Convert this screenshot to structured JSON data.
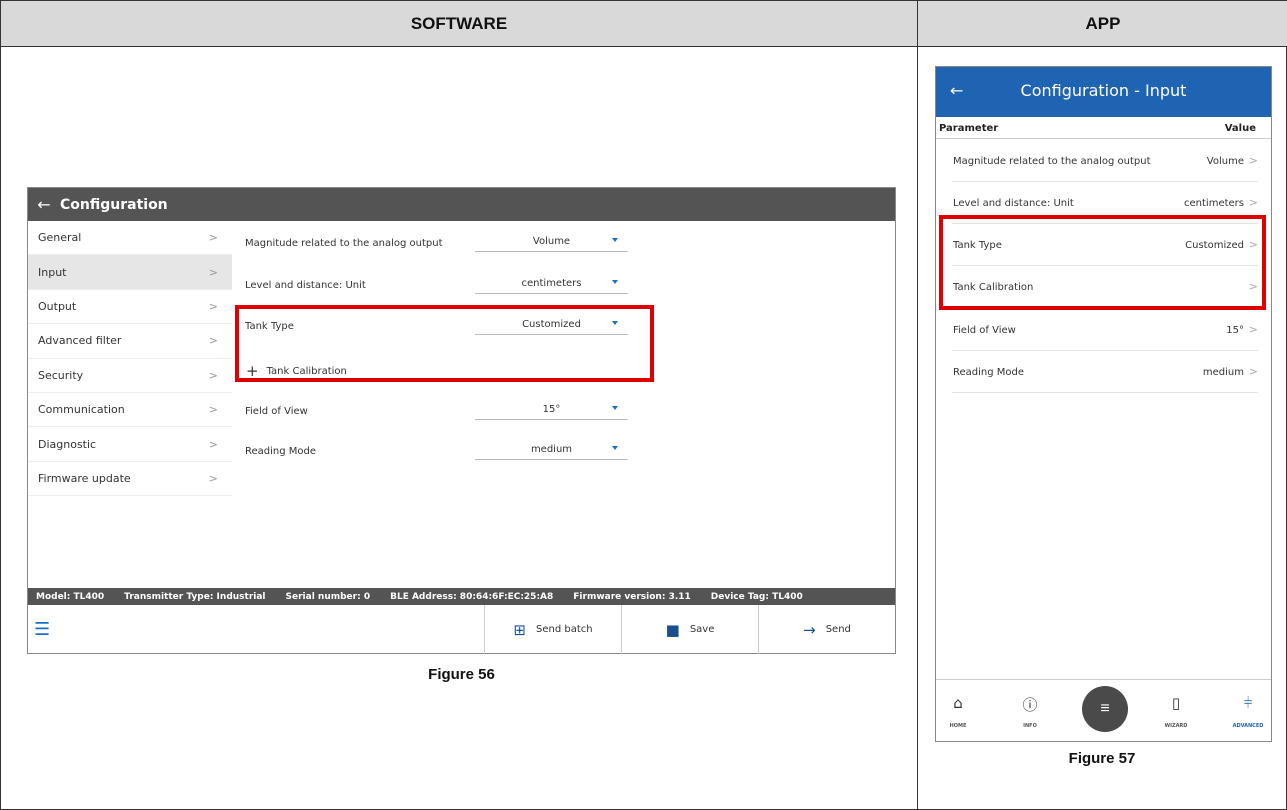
{
  "table": {
    "software_header": "SOFTWARE",
    "app_header": "APP",
    "software_caption": "Figure 56",
    "app_caption": "Figure 57"
  },
  "software": {
    "back_icon": "arrow-left-icon",
    "title": "Configuration",
    "sidebar": [
      {
        "label": "General",
        "active": false
      },
      {
        "label": "Input",
        "active": true
      },
      {
        "label": "Output",
        "active": false
      },
      {
        "label": "Advanced filter",
        "active": false
      },
      {
        "label": "Security",
        "active": false
      },
      {
        "label": "Communication",
        "active": false
      },
      {
        "label": "Diagnostic",
        "active": false
      },
      {
        "label": "Firmware update",
        "active": false
      }
    ],
    "rows": {
      "magnitude": {
        "label": "Magnitude related to the analog output",
        "value": "Volume"
      },
      "unit": {
        "label": "Level and distance: Unit",
        "value": "centimeters"
      },
      "tank_type": {
        "label": "Tank Type",
        "value": "Customized"
      },
      "field_of_view": {
        "label": "Field of View",
        "value": "15°"
      },
      "reading_mode": {
        "label": "Reading Mode",
        "value": "medium"
      }
    },
    "tank_calibration": "Tank Calibration",
    "status": {
      "model": "Model: TL400",
      "transmitter": "Transmitter Type: Industrial",
      "serial": "Serial number: 0",
      "ble": "BLE Address: 80:64:6F:EC:25:A8",
      "firmware": "Firmware version: 3.11",
      "tag": "Device Tag: TL400"
    },
    "buttons": {
      "send_batch": "Send batch",
      "save": "Save",
      "send": "Send"
    },
    "accent_color": "#1a6fc9",
    "highlight_color": "#e00000"
  },
  "app": {
    "title": "Configuration - Input",
    "param_header": "Parameter",
    "value_header": "Value",
    "rows": [
      {
        "label": "Magnitude related to the analog output",
        "value": "Volume"
      },
      {
        "label": "Level and distance: Unit",
        "value": "centimeters"
      },
      {
        "label": "Tank Type",
        "value": "Customized"
      },
      {
        "label": "Tank Calibration",
        "value": ""
      },
      {
        "label": "Field of View",
        "value": "15°"
      },
      {
        "label": "Reading Mode",
        "value": "medium"
      }
    ],
    "nav": {
      "home": "HOME",
      "info": "INFO",
      "wizard": "WIZARD",
      "advanced": "ADVANCED"
    },
    "header_color": "#1f63b3"
  }
}
